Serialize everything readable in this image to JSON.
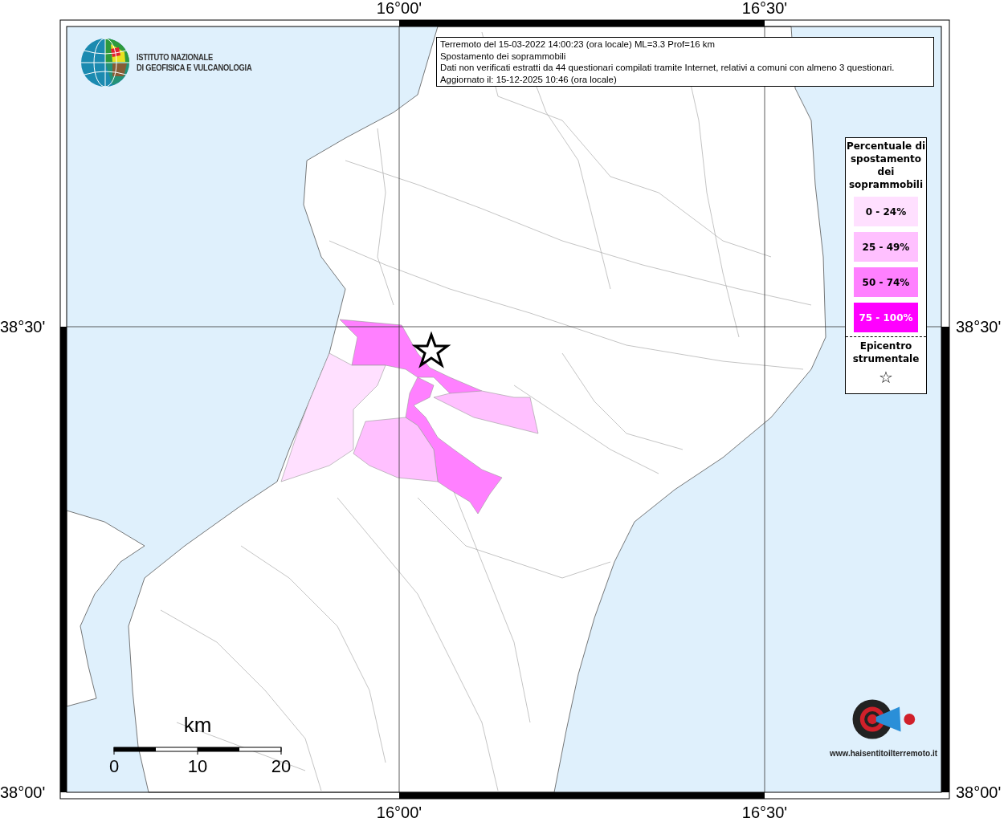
{
  "map": {
    "title_box": [
      "Terremoto del 15-03-2022 14:00:23 (ora locale) ML=3.3 Prof=16 km",
      "Spostamento dei soprammobili",
      "Dati non verificati estratti da 44 questionari compilati tramite Internet, relativi a comuni con almeno 3 questionari.",
      "Aggiornato il: 15-12-2025 10:46 (ora locale)"
    ],
    "institute_logo": {
      "lines": [
        "ISTITUTO NAZIONALE",
        "DI GEOFISICA E VULCANOLOGIA"
      ]
    },
    "longitude_ticks_top": [
      "16°00'",
      "16°30'"
    ],
    "latitude_ticks_left": [
      "38°30'",
      "38°00'"
    ],
    "latitude_ticks_right": [
      "38°30'",
      "38°00'"
    ],
    "longitude_ticks_bottom": [
      "16°00'",
      "16°30'"
    ],
    "areas": [
      {
        "color": "#ff80ff"
      },
      {
        "color": "#ff80ff"
      },
      {
        "color": "#ffc0ff"
      },
      {
        "color": "#ffc0ff"
      },
      {
        "color": "#ffe0ff"
      }
    ],
    "scale_bar": {
      "unit": "km",
      "labels": [
        "0",
        "10",
        "20"
      ]
    },
    "site_logo": {
      "text": "www.haisentitoilterremoto.it"
    }
  },
  "legend": {
    "title": "Percentuale di spostamento dei soprammobili",
    "classes": [
      {
        "label": "0 - 24%",
        "color": "#ffe0ff"
      },
      {
        "label": "25 - 49%",
        "color": "#ffc0ff"
      },
      {
        "label": "50 - 74%",
        "color": "#ff80ff"
      },
      {
        "label": "75 - 100%",
        "color": "#ff00ff"
      }
    ],
    "epicenter_label": "Epicentro strumentale",
    "epicenter_symbol": "☆"
  }
}
